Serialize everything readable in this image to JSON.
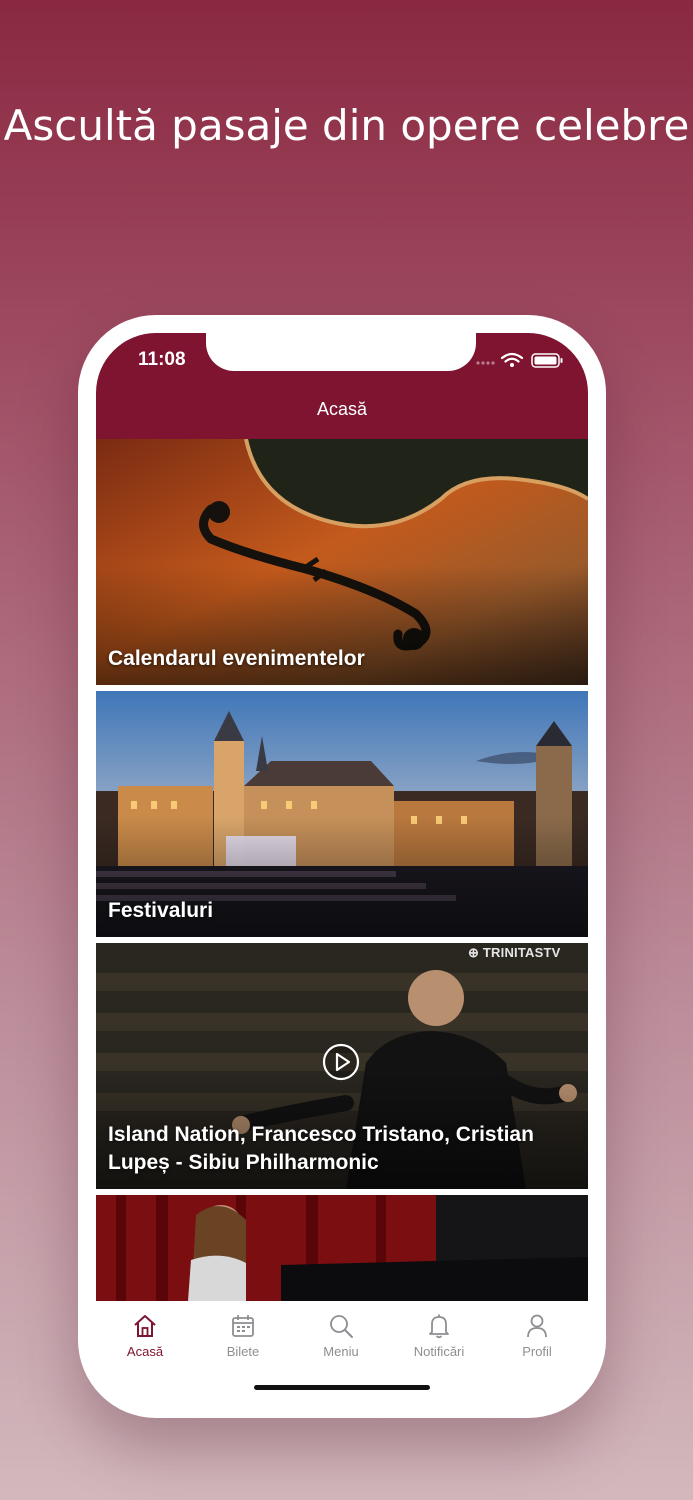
{
  "headline": "Ascultă pasaje din opere celebre",
  "status_bar": {
    "time": "11:08"
  },
  "header": {
    "title": "Acasă"
  },
  "cards": [
    {
      "title": "Calendarul evenimentelor",
      "image": "violin-f-hole-photo"
    },
    {
      "title": "Festivaluri",
      "image": "sibiu-square-night-concert-photo"
    },
    {
      "title": "Island Nation, Francesco Tristano, Cristian Lupeș - Sibiu Philharmonic",
      "image": "conductor-video-thumbnail",
      "watermark": "TRINITASTV",
      "icon": "play-icon"
    },
    {
      "title": "",
      "image": "girl-at-piano-photo"
    }
  ],
  "tabs": [
    {
      "label": "Acasă",
      "icon": "home-icon",
      "active": true
    },
    {
      "label": "Bilete",
      "icon": "calendar-icon",
      "active": false
    },
    {
      "label": "Meniu",
      "icon": "search-icon",
      "active": false
    },
    {
      "label": "Notificări",
      "icon": "bell-icon",
      "active": false
    },
    {
      "label": "Profil",
      "icon": "person-icon",
      "active": false
    }
  ],
  "colors": {
    "brand": "#7e1430",
    "tab_inactive": "#8e8e93",
    "background_top": "#8a2841",
    "background_bottom": "#d2b8bd"
  }
}
